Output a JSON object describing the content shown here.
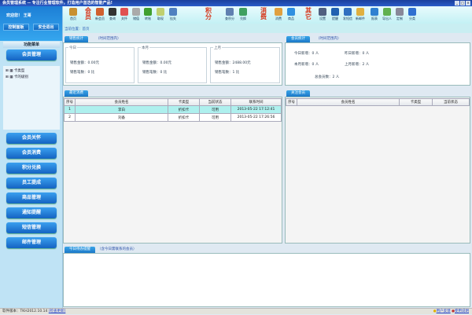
{
  "window": {
    "title": "会员管理系统 -- 专注行业管理软件，打造用户首选的智能产品!"
  },
  "user": {
    "welcome": "欢迎您！ 王哥",
    "control_panel": "控制面板",
    "logout": "安全退出"
  },
  "toolbar": {
    "groups": [
      {
        "label": "会员",
        "pos": 1
      },
      {
        "label": "积分",
        "pos": 9
      },
      {
        "label": "消费",
        "pos": 12
      },
      {
        "label": "其它",
        "pos": 15
      }
    ],
    "items": [
      {
        "label": "首页",
        "icon": "home-icon",
        "color": "#c89030"
      },
      {
        "label": "新会员",
        "icon": "new-member-icon",
        "color": "#d06030"
      },
      {
        "label": "查询",
        "icon": "binoculars-icon",
        "color": "#333"
      },
      {
        "label": "关怀",
        "icon": "heart-icon",
        "color": "#e05050"
      },
      {
        "label": "储值",
        "icon": "money-bag-icon",
        "color": "#aaa"
      },
      {
        "label": "转账",
        "icon": "transfer-icon",
        "color": "#40a030"
      },
      {
        "label": "取现",
        "icon": "cash-icon",
        "color": "#c0d070"
      },
      {
        "label": "挂失",
        "icon": "report-loss-icon",
        "color": "#5080c0"
      },
      {
        "label": "查积分",
        "icon": "points-query-icon",
        "color": "#6080b0"
      },
      {
        "label": "兑换",
        "icon": "exchange-icon",
        "color": "#40a060"
      },
      {
        "label": "消费",
        "icon": "consume-icon",
        "color": "#e0a040"
      },
      {
        "label": "商品",
        "icon": "product-icon",
        "color": "#3090e0"
      },
      {
        "label": "设置",
        "icon": "settings-icon",
        "color": "#506080"
      },
      {
        "label": "提醒",
        "icon": "clock-icon",
        "color": "#2060b0"
      },
      {
        "label": "发短信",
        "icon": "sms-icon",
        "color": "#3070c0"
      },
      {
        "label": "新邮件",
        "icon": "mail-icon",
        "color": "#e0b040"
      },
      {
        "label": "报表",
        "icon": "report-icon",
        "color": "#3080d0"
      },
      {
        "label": "导出人",
        "icon": "export-icon",
        "color": "#60b050"
      },
      {
        "label": "定制",
        "icon": "database-icon",
        "color": "#889"
      },
      {
        "label": "分类",
        "icon": "wand-icon",
        "color": "#3070d0"
      }
    ]
  },
  "breadcrumb": {
    "prefix": "当前位置：",
    "current": "首页"
  },
  "sidebar": {
    "header": "功能菜单",
    "top_button": "会员管理",
    "tree": [
      "卡类型",
      "卡的级别"
    ],
    "buttons": [
      "会员关怀",
      "会员消费",
      "积分兑换",
      "员工提成",
      "商品管理",
      "通知提醒",
      "短信管理",
      "邮件管理"
    ]
  },
  "sales": {
    "tab": "销售统计",
    "note": "（时间范围内）",
    "groups": [
      {
        "title": "今日",
        "amount": "销售金额：0.00元",
        "count": "销售笔数：0  比"
      },
      {
        "title": "本月",
        "amount": "销售金额：0.00元",
        "count": "销售笔数：0  比"
      },
      {
        "title": "上月",
        "amount": "销售金额：2488.00元",
        "count": "销售笔数：1  比"
      }
    ]
  },
  "members": {
    "tab": "会员统计",
    "note": "（时间范围内）",
    "today": "今日新增：0 人",
    "yesterday": "昨日新增：0 人",
    "this_month": "本月新增：0 人",
    "last_month": "上月新增：2 人",
    "total": "总会员数：2 人"
  },
  "recent": {
    "tab": "最近消费",
    "columns": [
      "序号",
      "会员姓名",
      "卡类型",
      "当前状态",
      "联系时间"
    ],
    "rows": [
      [
        "1",
        "李白",
        "折扣卡",
        "可用",
        "2013-05-22 17:12:41"
      ],
      [
        "2",
        "刘备",
        "折扣卡",
        "可用",
        "2013-05-22 17:26:56"
      ]
    ]
  },
  "follow": {
    "tab": "关注会员",
    "columns": [
      "序号",
      "会员姓名",
      "卡类型",
      "当前状态"
    ]
  },
  "todo": {
    "tab": "今日待办提醒",
    "note": "（含今日需联系的会员）"
  },
  "status": {
    "version": "软件版本：TKH2012.10.14",
    "check_update": "[检查更新]",
    "feedback": "用户反馈",
    "manual": "使用说明"
  }
}
